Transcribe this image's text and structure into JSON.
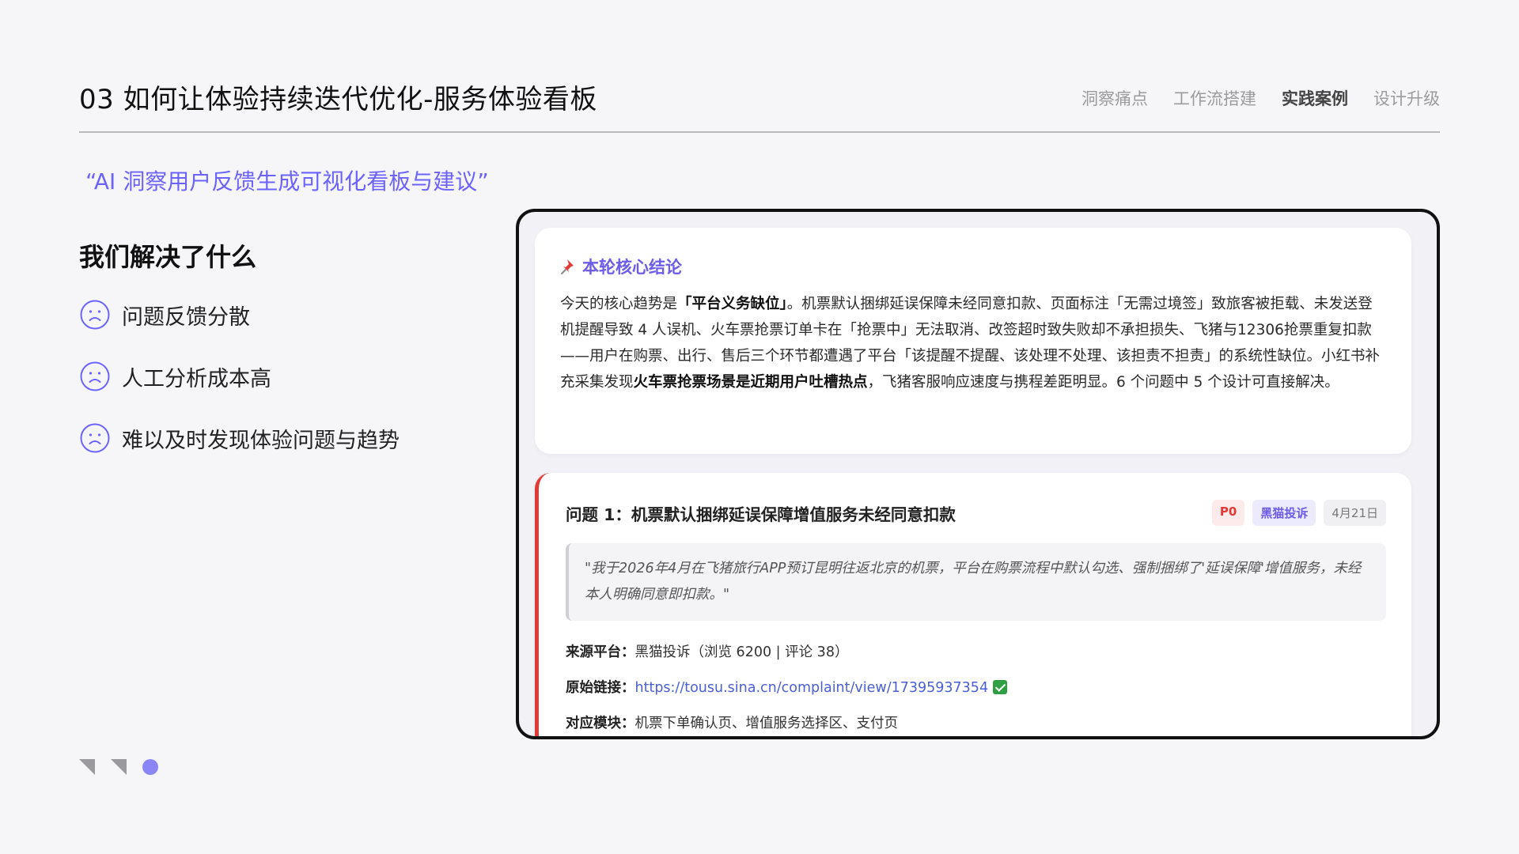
{
  "header": {
    "title": "03 如何让体验持续迭代优化-服务体验看板",
    "nav": [
      {
        "label": "洞察痛点",
        "active": false
      },
      {
        "label": "工作流搭建",
        "active": false
      },
      {
        "label": "实践案例",
        "active": true
      },
      {
        "label": "设计升级",
        "active": false
      }
    ]
  },
  "quote": "“AI 洞察用户反馈生成可视化看板与建议”",
  "solved": {
    "heading": "我们解决了什么",
    "items": [
      {
        "icon": "sad-face-icon",
        "label": "问题反馈分散"
      },
      {
        "icon": "sad-face-icon",
        "label": "人工分析成本高"
      },
      {
        "icon": "sad-face-icon",
        "label": "难以及时发现体验问题与趋势"
      }
    ]
  },
  "dashboard": {
    "conclusion": {
      "icon": "pushpin-icon",
      "title": "本轮核心结论",
      "p1": "今天的核心趋势是",
      "b1": "「平台义务缺位」",
      "p2": "。机票默认捆绑延误保障未经同意扣款、页面标注「无需过境签」致旅客被拒载、未发送登机提醒导致 4 人误机、火车票抢票订单卡在「抢票中」无法取消、改签超时致失败却不承担损失、飞猪与12306抢票重复扣款——用户在购票、出行、售后三个环节都遭遇了平台「该提醒不提醒、该处理不处理、该担责不担责」的系统性缺位。小红书补充采集发现",
      "b2": "火车票抢票场景是近期用户吐槽热点",
      "p3": "，飞猪客服响应速度与携程差距明显。6 个问题中 5 个设计可直接解决。"
    },
    "issue": {
      "title": "问题 1：机票默认捆绑延误保障增值服务未经同意扣款",
      "priority": "P0",
      "source_badge": "黑猫投诉",
      "date": "4月21日",
      "quote": "\"我于2026年4月在飞猪旅行APP预订昆明往返北京的机票，平台在购票流程中默认勾选、强制捆绑了'延误保障'增值服务，未经本人明确同意即扣款。\"",
      "source_label": "来源平台：",
      "source_value": "黑猫投诉（浏览 6200 | 评论 38）",
      "link_label": "原始链接：",
      "link_value": "https://tousu.sina.cn/complaint/view/17395937354",
      "link_icon": "check-mark-icon",
      "module_label": "对应模块：",
      "module_value": "机票下单确认页、增值服务选择区、支付页"
    }
  },
  "colors": {
    "accent": "#6c63ff",
    "priority_red": "#e53935",
    "link_blue": "#4a5fd8"
  }
}
